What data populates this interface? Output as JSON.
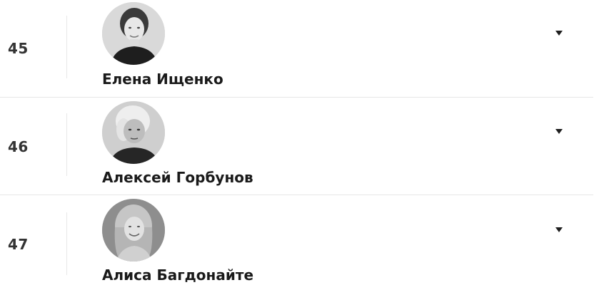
{
  "list": {
    "rows": [
      {
        "rank": "45",
        "name": "Елена Ищенко",
        "photo_icon": "person-portrait-icon",
        "expand_icon": "caret-down-icon"
      },
      {
        "rank": "46",
        "name": "Алексей Горбунов",
        "photo_icon": "person-portrait-icon",
        "expand_icon": "caret-down-icon"
      },
      {
        "rank": "47",
        "name": "Алиса Багдонайте",
        "photo_icon": "person-portrait-icon",
        "expand_icon": "caret-down-icon"
      }
    ]
  },
  "colors": {
    "text": "#1a1a1a",
    "rank_text": "#333333",
    "separator": "#e6e6e6",
    "caret": "#1f1f1f"
  }
}
